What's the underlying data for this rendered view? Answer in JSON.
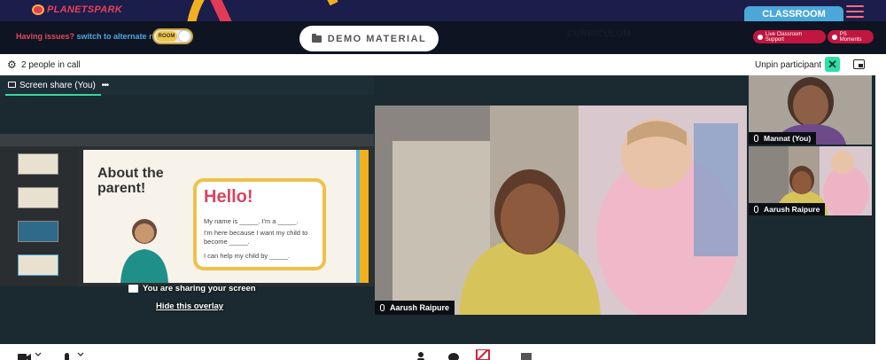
{
  "brand": {
    "logo_text": "PLANETSPARK"
  },
  "header": {
    "classroom_tab": "CLASSROOM",
    "issue_question": "Having issues?",
    "issue_action": "switch to alternate room",
    "room_toggle_label": "ROOM",
    "demo_material_label": "DEMO MATERIAL",
    "curriculum_label": "CURRICULUM",
    "live_support_label": "Live Classroom Support",
    "ps_moments_label": "PS Moments"
  },
  "call": {
    "people_count_label": "2 people in call",
    "unpin_label": "Unpin participant"
  },
  "screen_share": {
    "title": "Screen share (You)",
    "more_label": "•••",
    "overlay_message": "You are sharing your screen",
    "overlay_link": "Hide this overlay"
  },
  "slide": {
    "title": "About the parent!",
    "hello": "Hello!",
    "line1": "My name is _____. I'm a _____.",
    "line2": "I'm here because I want my child to become _____.",
    "line3": "I can help my child by _____."
  },
  "participants": [
    {
      "name": "Aarush Raipure"
    },
    {
      "name": "Mannat (You)"
    },
    {
      "name": "Aarush Raipure"
    }
  ],
  "colors": {
    "topbar": "#1b1d4a",
    "accent_green": "#2de0a6",
    "pill_red": "#c0163f",
    "classroom_blue": "#4aa7d8"
  },
  "icons": {
    "settings": "gear-icon",
    "unpin": "close-icon",
    "layout": "layout-icon",
    "folder": "folder-icon"
  }
}
